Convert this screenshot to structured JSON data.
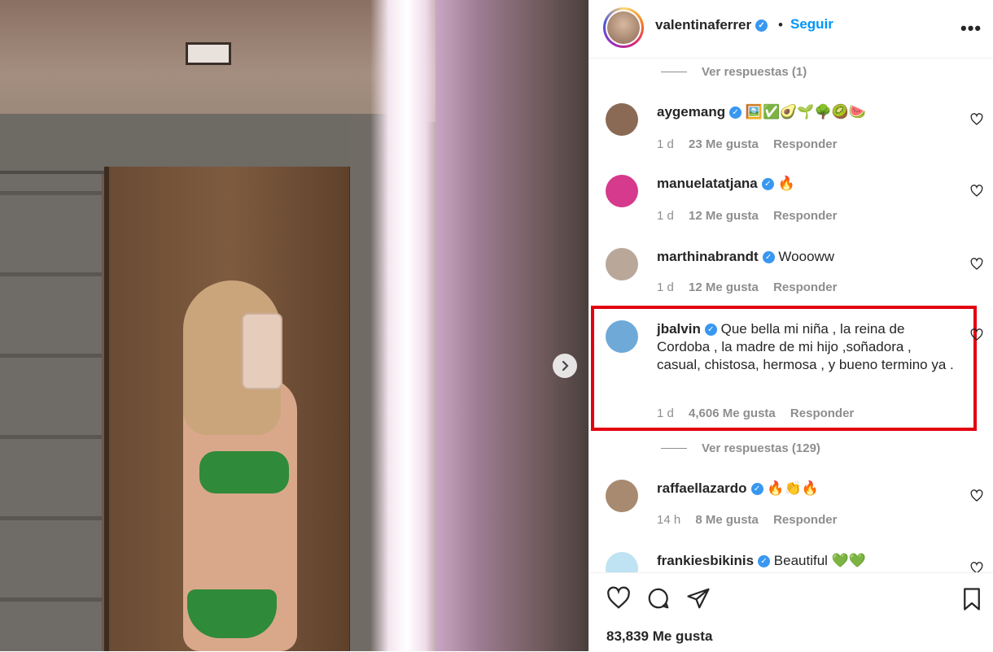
{
  "post": {
    "username": "valentinaferrer",
    "follow_label": "Seguir",
    "dot": "•",
    "more_label": "•••",
    "likes_text": "83,839 Me gusta"
  },
  "replies_top": "Ver respuestas (1)",
  "replies_mid": "Ver respuestas (129)",
  "comments": [
    {
      "user": "aygemang",
      "text": "🖼️✅🥑🌱🌳🥝🍉",
      "time": "1 d",
      "likes": "23 Me gusta",
      "reply": "Responder",
      "avatar_color": "#8a6a55"
    },
    {
      "user": "manuelatatjana",
      "text": "🔥",
      "time": "1 d",
      "likes": "12 Me gusta",
      "reply": "Responder",
      "avatar_color": "#d63a8c"
    },
    {
      "user": "marthinabrandt",
      "text": "Woooww",
      "time": "1 d",
      "likes": "12 Me gusta",
      "reply": "Responder",
      "avatar_color": "#b9a89a"
    },
    {
      "user": "jbalvin",
      "text": "Que bella mi niña , la reina de Cordoba , la madre de mi hijo ,soñadora , casual, chistosa, hermosa , y bueno termino ya .",
      "time": "1 d",
      "likes": "4,606 Me gusta",
      "reply": "Responder",
      "avatar_color": "#6fa9d8"
    },
    {
      "user": "raffaellazardo",
      "text": "🔥👏🔥",
      "time": "14 h",
      "likes": "8 Me gusta",
      "reply": "Responder",
      "avatar_color": "#a78a70"
    },
    {
      "user": "frankiesbikinis",
      "text": "Beautiful 💚💚",
      "time": "",
      "likes": "",
      "reply": "",
      "avatar_color": "#bfe3f2"
    }
  ],
  "colors": {
    "accent": "#0095f6",
    "verified": "#3897f0",
    "highlight": "#e3010f"
  }
}
